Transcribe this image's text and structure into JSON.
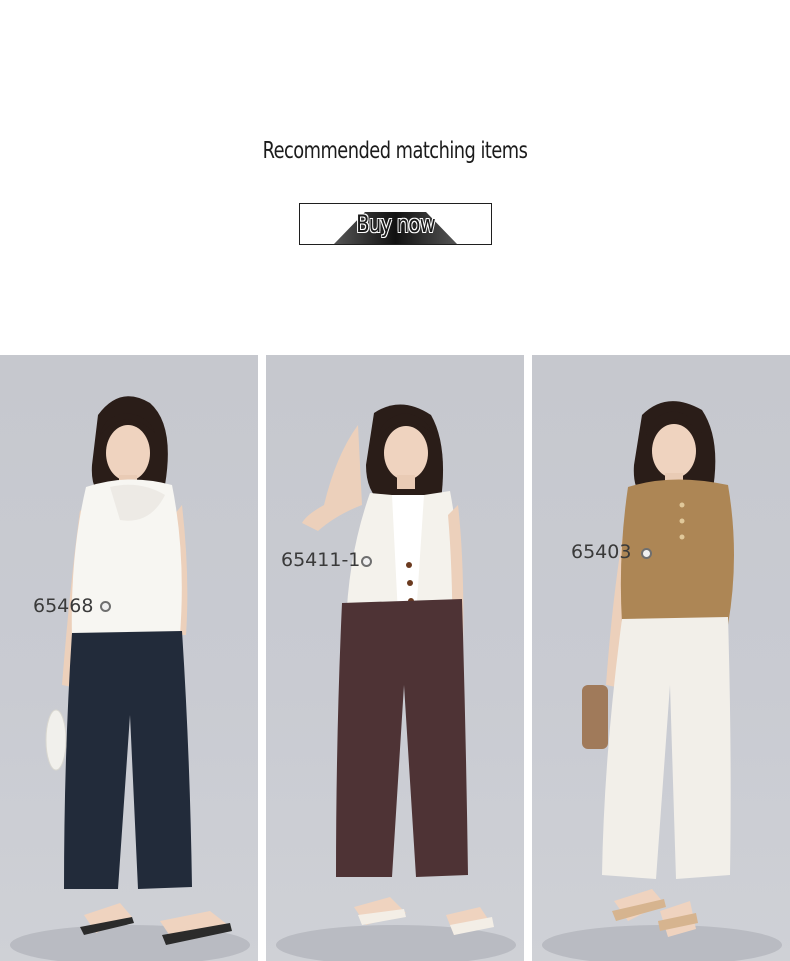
{
  "section": {
    "heading": "Recommended matching items",
    "buy_label": "Buy now"
  },
  "products": [
    {
      "code": "65468",
      "top_color": "#f7f6f2",
      "bottom_color": "#222b3a"
    },
    {
      "code": "65411-1",
      "top_color": "#f4f2ec",
      "bottom_color": "#4e3335"
    },
    {
      "code": "65403",
      "top_color": "#ad8655",
      "bottom_color": "#f2efe9"
    }
  ]
}
